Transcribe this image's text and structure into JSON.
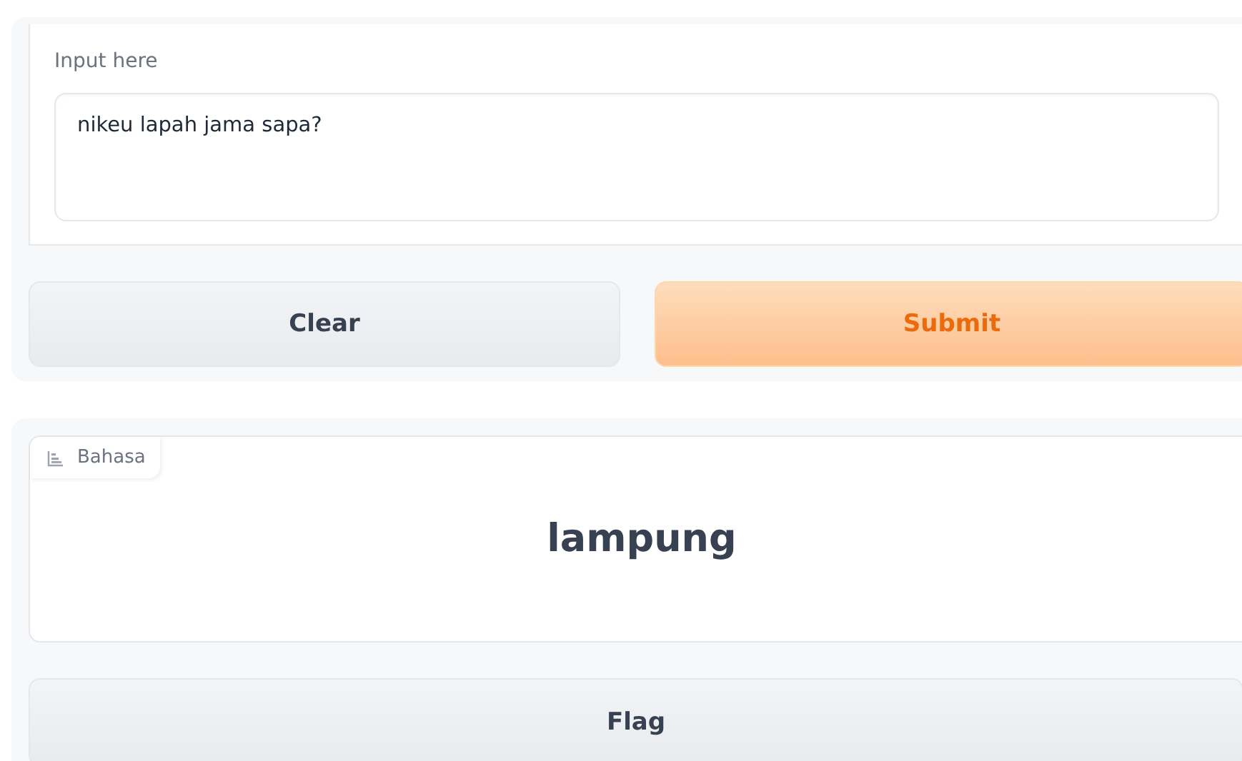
{
  "input": {
    "label": "Input here",
    "value": "nikeu lapah jama sapa?"
  },
  "buttons": [
    {
      "label": "Clear",
      "kind": "secondary"
    },
    {
      "label": "Submit",
      "kind": "primary"
    }
  ],
  "output": {
    "label": "Bahasa",
    "value": "lampung"
  },
  "flag_button": {
    "label": "Flag"
  }
}
